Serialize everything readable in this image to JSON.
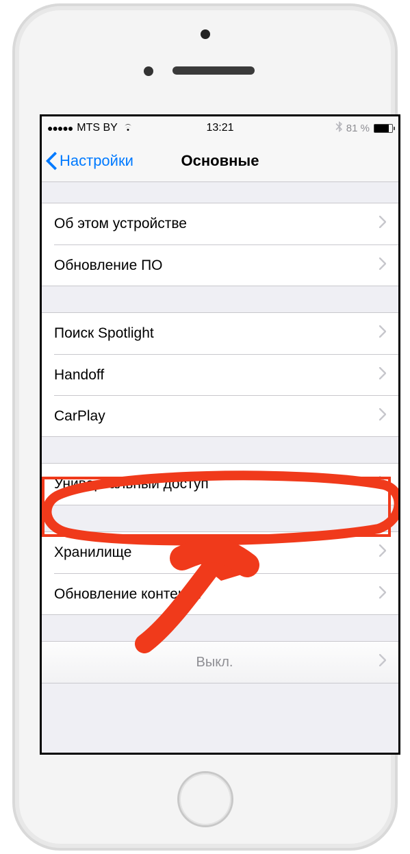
{
  "status": {
    "carrier": "MTS BY",
    "time": "13:21",
    "battery_pct": "81 %"
  },
  "nav": {
    "back": "Настройки",
    "title": "Основные"
  },
  "groups": [
    {
      "rows": [
        {
          "label": "Об этом устройстве"
        },
        {
          "label": "Обновление ПО"
        }
      ]
    },
    {
      "rows": [
        {
          "label": "Поиск Spotlight"
        },
        {
          "label": "Handoff"
        },
        {
          "label": "CarPlay"
        }
      ]
    },
    {
      "rows": [
        {
          "label": "Универсальный доступ"
        }
      ]
    },
    {
      "rows": [
        {
          "label": "Хранилище"
        },
        {
          "label": "Обновление контента"
        }
      ]
    },
    {
      "rows": [
        {
          "label": "",
          "value": "Выкл."
        }
      ]
    }
  ],
  "annotation": {
    "color": "#f03a1b",
    "highlight_row_label": "Универсальный доступ"
  }
}
